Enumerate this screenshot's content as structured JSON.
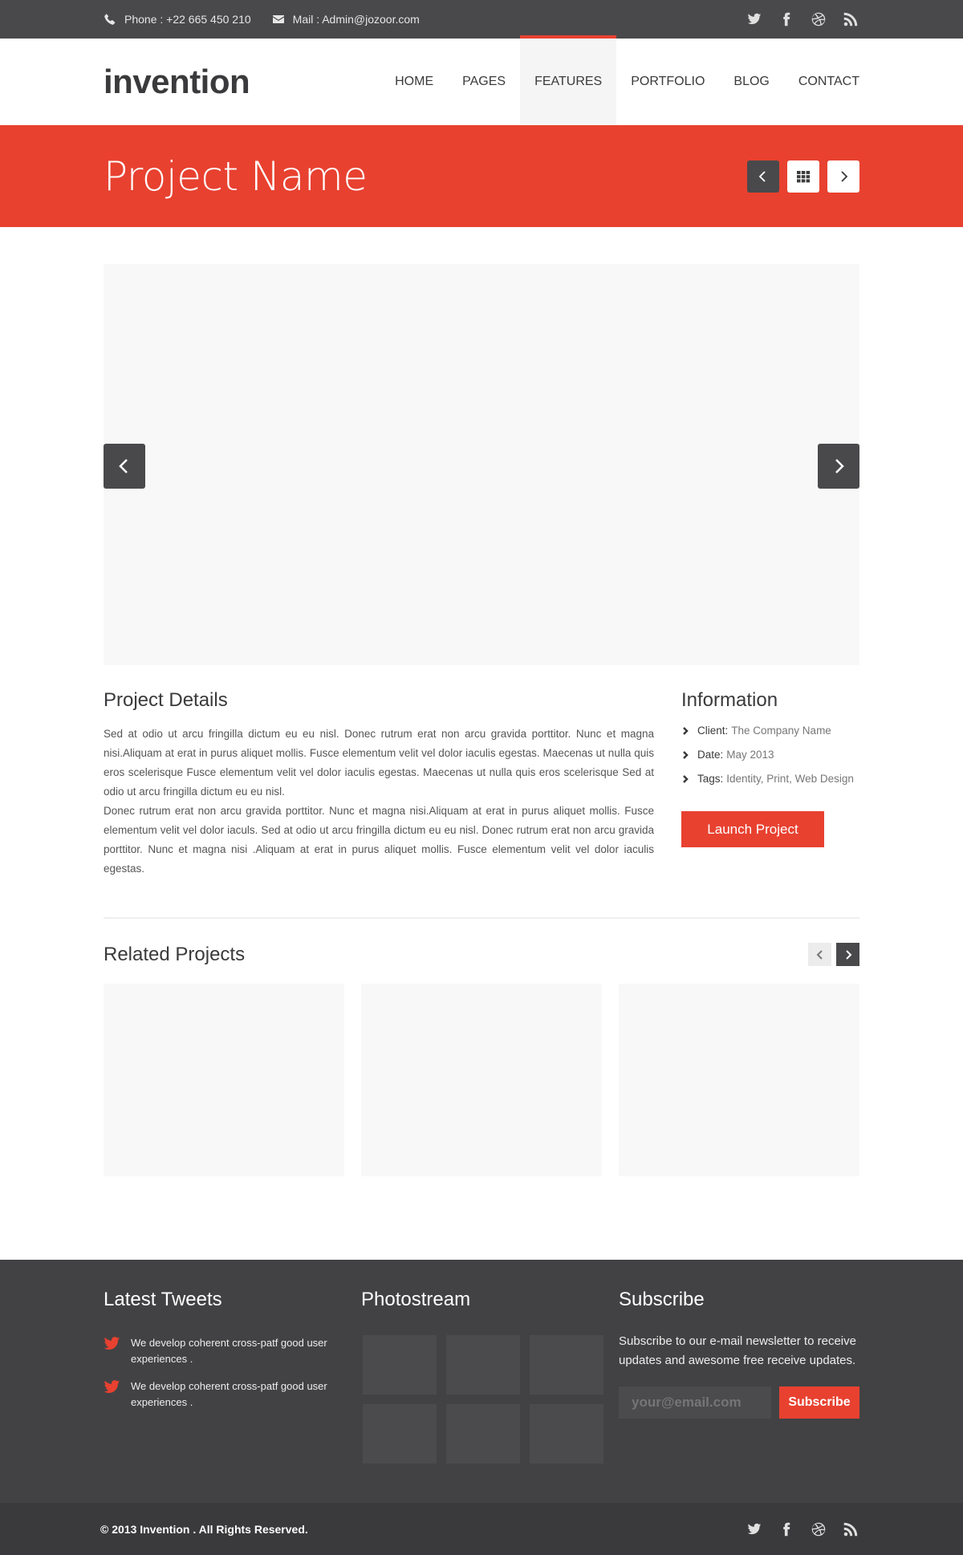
{
  "topbar": {
    "phone": "Phone : +22 665 450 210",
    "mail": "Mail : Admin@jozoor.com",
    "social_icons": [
      "twitter-icon",
      "facebook-icon",
      "dribbble-icon",
      "rss-icon"
    ]
  },
  "header": {
    "logo": "invention",
    "nav": [
      {
        "label": "HOME"
      },
      {
        "label": "PAGES"
      },
      {
        "label": "FEATURES",
        "active": true
      },
      {
        "label": "PORTFOLIO"
      },
      {
        "label": "BLOG"
      },
      {
        "label": "CONTACT"
      }
    ]
  },
  "title_band": {
    "title": "Project Name"
  },
  "project_details": {
    "heading": "Project Details",
    "paragraph1": "Sed at odio ut arcu fringilla dictum eu eu nisl. Donec rutrum erat non arcu gravida porttitor. Nunc et magna nisi.Aliquam at erat in purus aliquet mollis. Fusce elementum velit vel dolor iaculis egestas. Maecenas ut nulla quis eros scelerisque Fusce elementum velit vel dolor iaculis egestas. Maecenas ut nulla quis eros scelerisque Sed at odio ut arcu fringilla dictum eu eu nisl.",
    "paragraph2": "Donec rutrum erat non arcu gravida porttitor. Nunc et magna nisi.Aliquam at erat in purus aliquet mollis. Fusce elementum velit vel dolor iaculs. Sed at odio ut arcu fringilla dictum eu eu nisl. Donec rutrum erat non arcu gravida porttitor. Nunc et magna nisi .Aliquam at erat in purus aliquet mollis. Fusce elementum velit vel dolor iaculis egestas."
  },
  "information": {
    "heading": "Information",
    "client_label": "Client:",
    "client_value": "The Company Name",
    "date_label": "Date:",
    "date_value": "May 2013",
    "tags_label": "Tags:",
    "tags_value": "Identity, Print, Web Design",
    "launch_button": "Launch Project"
  },
  "related": {
    "heading": "Related Projects"
  },
  "footer": {
    "tweets_heading": "Latest Tweets",
    "tweets": [
      {
        "text": "We develop coherent cross-patf good user experiences ."
      },
      {
        "text": "We develop coherent cross-patf good user experiences ."
      }
    ],
    "photostream_heading": "Photostream",
    "subscribe_heading": "Subscribe",
    "subscribe_text": "Subscribe to our e-mail newsletter to receive updates and awesome free receive updates.",
    "email_placeholder": "your@email.com",
    "subscribe_button": "Subscribe"
  },
  "bottombar": {
    "copyright": "© 2013 Invention . All Rights Reserved."
  },
  "colors": {
    "accent": "#e84130",
    "dark": "#49494b",
    "footer": "#424244"
  }
}
